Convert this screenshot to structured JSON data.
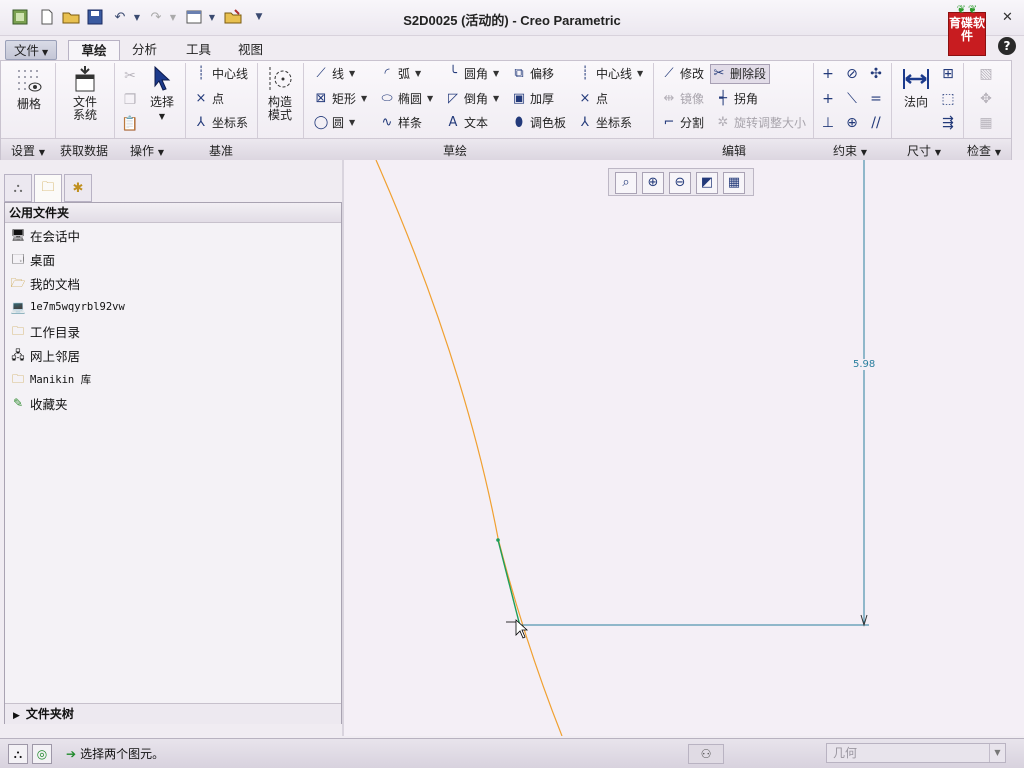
{
  "window": {
    "title": "S2D0025 (活动的) - Creo Parametric",
    "logo_text": "育碟软件",
    "help_label": "?"
  },
  "tabs": [
    {
      "label": "文件"
    },
    {
      "label": "草绘",
      "active": true
    },
    {
      "label": "分析"
    },
    {
      "label": "工具"
    },
    {
      "label": "视图"
    }
  ],
  "ribbon": {
    "settings": {
      "grid": "栅格",
      "group": "设置"
    },
    "getdata": {
      "file_system_line1": "文件",
      "file_system_line2": "系统",
      "group": "获取数据"
    },
    "operations": {
      "select": "选择",
      "group": "操作"
    },
    "datum": {
      "centerline": "中心线",
      "point": "点",
      "coord_sys": "坐标系",
      "group": "基准"
    },
    "construct": {
      "mode_line1": "构造",
      "mode_line2": "模式"
    },
    "sketch": {
      "line": "线",
      "rectangle": "矩形",
      "circle": "圆",
      "arc": "弧",
      "ellipse": "椭圆",
      "spline": "样条",
      "fillet": "圆角",
      "chamfer": "倒角",
      "text": "文本",
      "offset": "偏移",
      "thicken": "加厚",
      "palette": "调色板",
      "centerline": "中心线",
      "point": "点",
      "coord_sys": "坐标系",
      "group": "草绘"
    },
    "editing": {
      "modify": "修改",
      "delete_segment": "删除段",
      "mirror": "镜像",
      "corner": "拐角",
      "divide": "分割",
      "rotate_resize": "旋转调整大小",
      "group": "编辑"
    },
    "constrain": {
      "group": "约束"
    },
    "dimension": {
      "normal": "法向",
      "group": "尺寸"
    },
    "inspect": {
      "group": "检查"
    }
  },
  "navigator": {
    "header": "公用文件夹",
    "items": [
      {
        "label": "在会话中",
        "icon": "monitor-icon"
      },
      {
        "label": "桌面",
        "icon": "desktop-icon"
      },
      {
        "label": "我的文档",
        "icon": "folder-open-icon"
      },
      {
        "label": "1e7m5wqyrbl92vw",
        "icon": "computer-icon",
        "mono": true
      },
      {
        "label": "工作目录",
        "icon": "working-dir-icon"
      },
      {
        "label": "网上邻居",
        "icon": "network-icon"
      },
      {
        "label": "Manikin 库",
        "icon": "library-icon",
        "mono": true
      },
      {
        "label": "收藏夹",
        "icon": "favorites-icon"
      }
    ],
    "footer": "文件夹树"
  },
  "sketch_view": {
    "dimension_value": "5.98",
    "colors": {
      "curve": "#f0a030",
      "dimension": "#2a7f9e",
      "highlight": "#1e9e5a"
    }
  },
  "statusbar": {
    "message": "选择两个图元。",
    "filter_value": "几何"
  }
}
